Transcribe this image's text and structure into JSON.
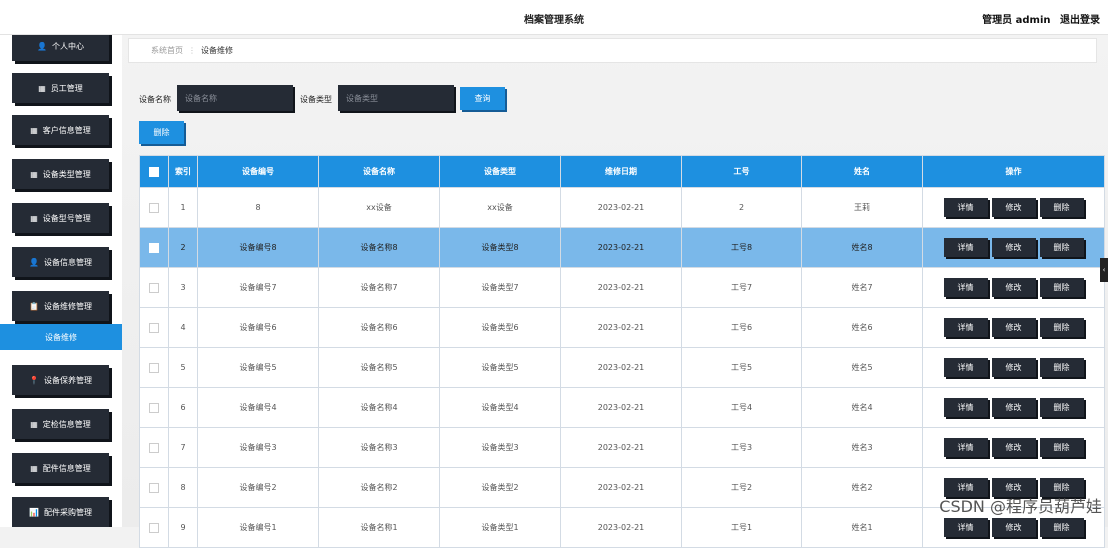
{
  "header": {
    "title": "档案管理系统",
    "user": "管理员 admin",
    "logout": "退出登录"
  },
  "sidebar": {
    "items": [
      {
        "label": "个人中心",
        "icon": "user-icon"
      },
      {
        "label": "员工管理",
        "icon": "grid-icon"
      },
      {
        "label": "客户信息管理",
        "icon": "grid-icon"
      },
      {
        "label": "设备类型管理",
        "icon": "grid-icon"
      },
      {
        "label": "设备型号管理",
        "icon": "grid-icon"
      },
      {
        "label": "设备信息管理",
        "icon": "user-icon"
      },
      {
        "label": "设备维修管理",
        "icon": "clipboard-icon"
      },
      {
        "label": "设备保养管理",
        "icon": "pin-icon"
      },
      {
        "label": "定检信息管理",
        "icon": "grid-icon"
      },
      {
        "label": "配件信息管理",
        "icon": "grid-icon"
      },
      {
        "label": "配件采购管理",
        "icon": "bar-chart-icon"
      }
    ],
    "active_sub": "设备维修"
  },
  "breadcrumb": {
    "home": "系统首页",
    "current": "设备维修"
  },
  "search": {
    "name_label": "设备名称",
    "name_placeholder": "设备名称",
    "type_label": "设备类型",
    "type_placeholder": "设备类型",
    "query_button": "查询"
  },
  "delete_button": "删除",
  "table": {
    "headers": [
      "索引",
      "设备编号",
      "设备名称",
      "设备类型",
      "维修日期",
      "工号",
      "姓名",
      "操作"
    ],
    "actions": [
      "详情",
      "修改",
      "删除"
    ],
    "rows": [
      {
        "index": "1",
        "code": "8",
        "name": "xx设备",
        "type": "xx设备",
        "date": "2023-02-21",
        "job": "2",
        "person": "王莉"
      },
      {
        "index": "2",
        "code": "设备编号8",
        "name": "设备名称8",
        "type": "设备类型8",
        "date": "2023-02-21",
        "job": "工号8",
        "person": "姓名8"
      },
      {
        "index": "3",
        "code": "设备编号7",
        "name": "设备名称7",
        "type": "设备类型7",
        "date": "2023-02-21",
        "job": "工号7",
        "person": "姓名7"
      },
      {
        "index": "4",
        "code": "设备编号6",
        "name": "设备名称6",
        "type": "设备类型6",
        "date": "2023-02-21",
        "job": "工号6",
        "person": "姓名6"
      },
      {
        "index": "5",
        "code": "设备编号5",
        "name": "设备名称5",
        "type": "设备类型5",
        "date": "2023-02-21",
        "job": "工号5",
        "person": "姓名5"
      },
      {
        "index": "6",
        "code": "设备编号4",
        "name": "设备名称4",
        "type": "设备类型4",
        "date": "2023-02-21",
        "job": "工号4",
        "person": "姓名4"
      },
      {
        "index": "7",
        "code": "设备编号3",
        "name": "设备名称3",
        "type": "设备类型3",
        "date": "2023-02-21",
        "job": "工号3",
        "person": "姓名3"
      },
      {
        "index": "8",
        "code": "设备编号2",
        "name": "设备名称2",
        "type": "设备类型2",
        "date": "2023-02-21",
        "job": "工号2",
        "person": "姓名2"
      },
      {
        "index": "9",
        "code": "设备编号1",
        "name": "设备名称1",
        "type": "设备类型1",
        "date": "2023-02-21",
        "job": "工号1",
        "person": "姓名1"
      }
    ]
  },
  "watermark": "CSDN @程序员葫芦娃",
  "colors": {
    "accent": "#1e90e0",
    "dark": "#252b35",
    "selected_row": "#7ab8ea"
  }
}
